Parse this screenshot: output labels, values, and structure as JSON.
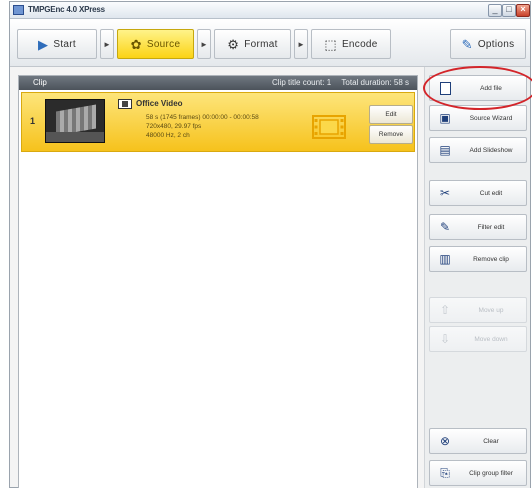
{
  "window": {
    "title": "TMPGEnc 4.0 XPress"
  },
  "controls": {
    "minimize": "_",
    "maximize": "□",
    "close": "×"
  },
  "toolbar": {
    "start_label": "Start",
    "source_label": "Source",
    "format_label": "Format",
    "encode_label": "Encode",
    "options_label": "Options",
    "step_arrow": "►"
  },
  "clip_list": {
    "header_label": "Clip",
    "clip_count": "Clip title count: 1",
    "total_duration": "Total duration: 58 s"
  },
  "clips": [
    {
      "number": "1",
      "title": "Office Video",
      "meta_line1": "58 s (1745 frames) 00:00:00 - 00:00:58",
      "meta_line2": "720x480, 29.97 fps",
      "meta_line3": "48000 Hz, 2 ch",
      "edit_label": "Edit",
      "remove_label": "Remove"
    }
  ],
  "sidebar": {
    "add_file": "Add file",
    "source_wizard": "Source Wizard",
    "add_slideshow": "Add Slideshow",
    "cut_edit": "Cut edit",
    "filter_edit": "Filter edit",
    "remove_clip": "Remove clip",
    "move_up": "Move up",
    "move_down": "Move down",
    "clear": "Clear",
    "clip_group_filter": "Clip group filter"
  },
  "colors": {
    "accent_yellow": "#f6c21c",
    "highlight_ring": "#d3252a",
    "header_dark": "#4c535b"
  }
}
